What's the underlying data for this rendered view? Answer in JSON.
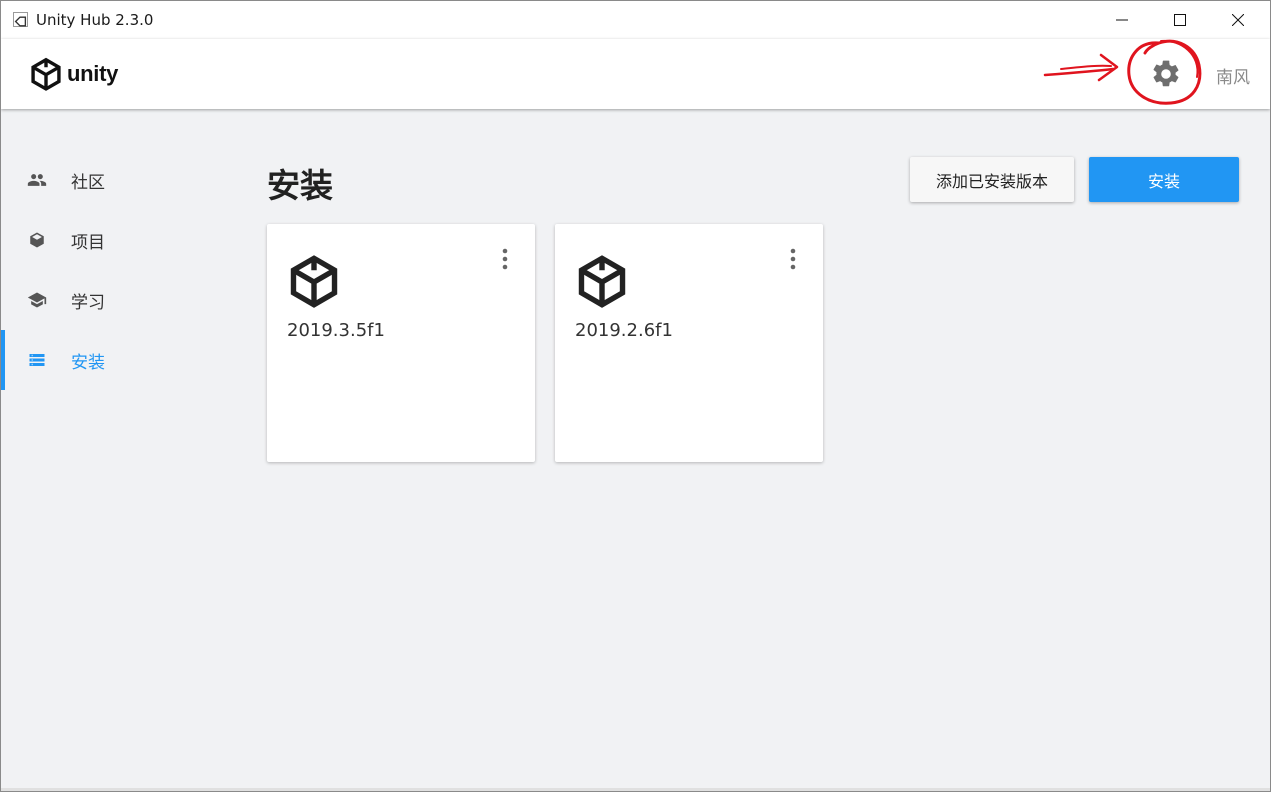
{
  "window": {
    "title": "Unity Hub 2.3.0",
    "icon": "unity-app-icon",
    "controls": [
      "minimize-icon",
      "maximize-icon",
      "close-icon"
    ]
  },
  "header": {
    "logo_text": "unity",
    "settings_icon": "gear-icon",
    "user_name": "南风"
  },
  "sidebar": {
    "items": [
      {
        "label": "社区",
        "icon": "community-icon",
        "active": false
      },
      {
        "label": "项目",
        "icon": "cube-icon",
        "active": false
      },
      {
        "label": "学习",
        "icon": "graduation-cap-icon",
        "active": false
      },
      {
        "label": "安装",
        "icon": "list-icon",
        "active": true
      }
    ]
  },
  "main": {
    "title": "安装",
    "add_installed_label": "添加已安装版本",
    "install_label": "安装",
    "installs": [
      {
        "version": "2019.3.5f1"
      },
      {
        "version": "2019.2.6f1"
      }
    ]
  },
  "colors": {
    "accent": "#2196f3",
    "background": "#f1f2f4",
    "annotation": "#e0141e"
  }
}
